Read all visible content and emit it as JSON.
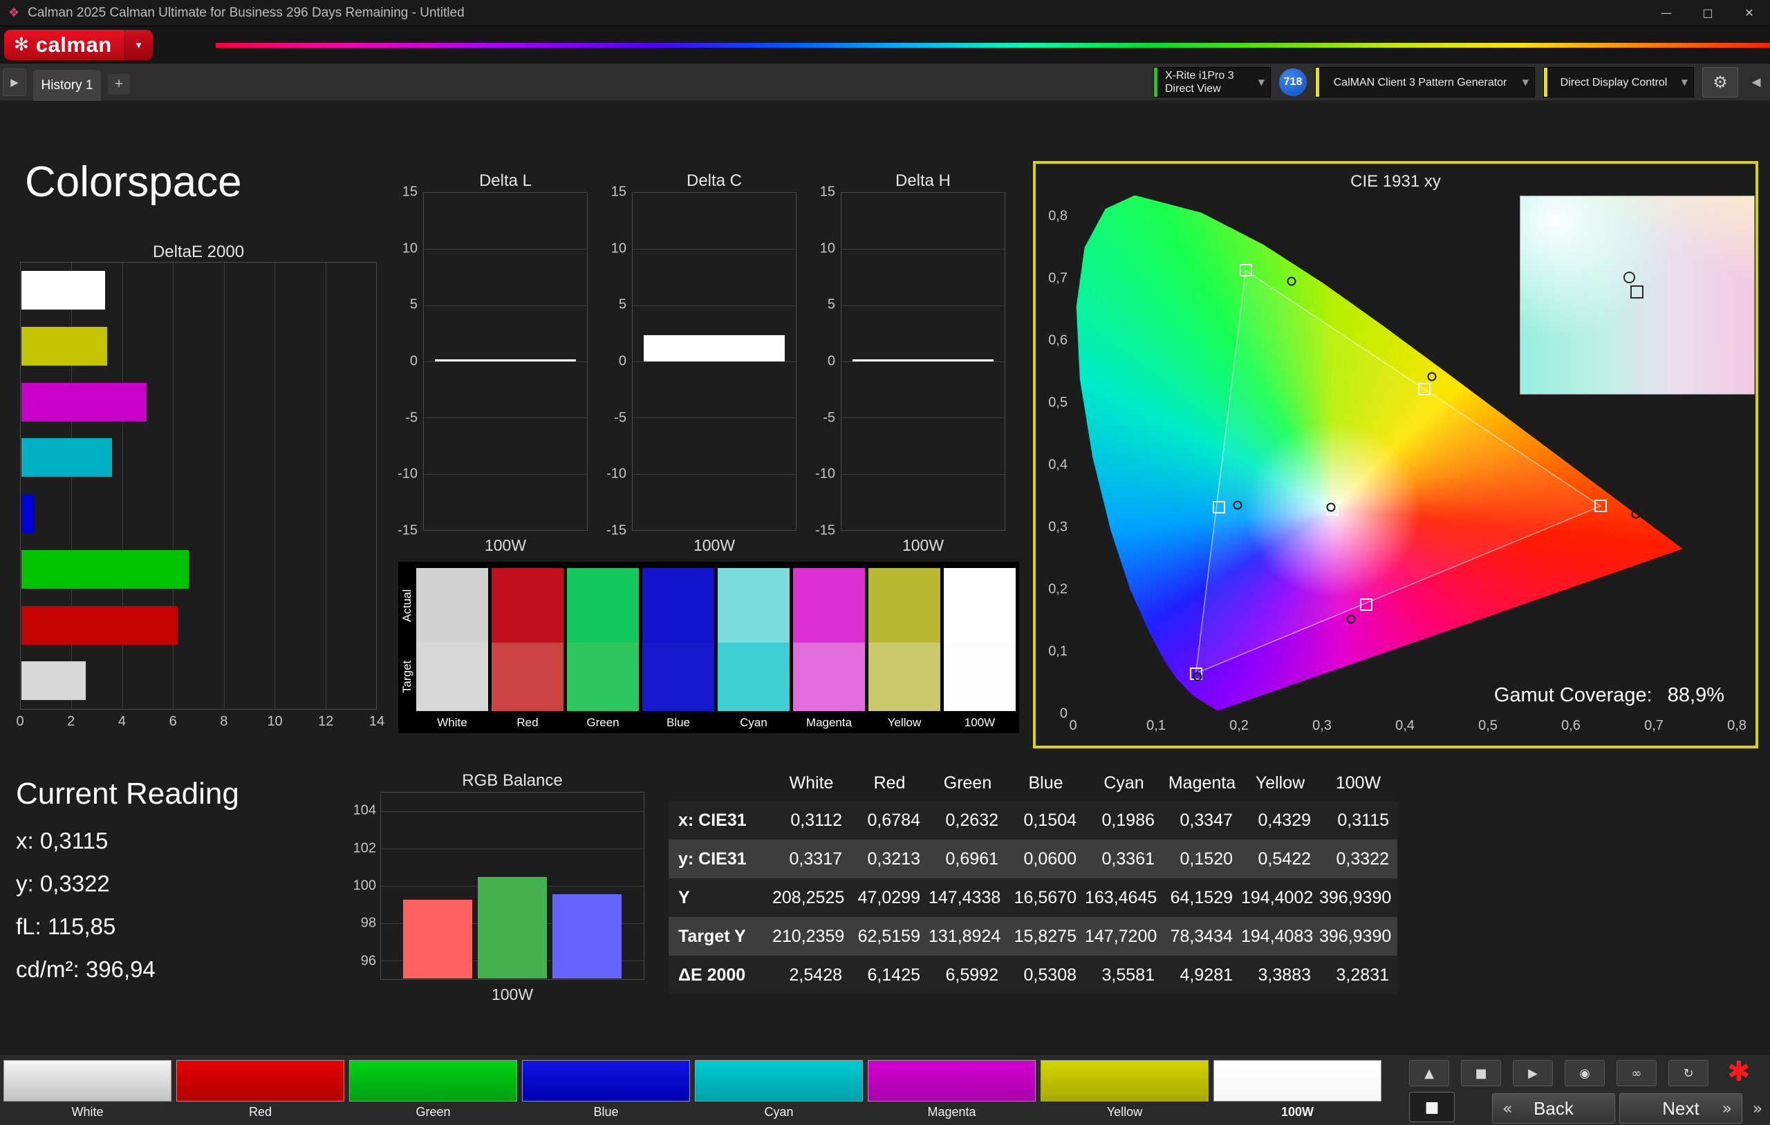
{
  "window": {
    "title": "Calman 2025 Calman Ultimate for Business 296 Days Remaining - Untitled"
  },
  "icons": {
    "app": "❖",
    "logo_flower": "✻",
    "menu_arrow": "▾",
    "dropdown_arrow": "▼",
    "expand": "▶",
    "collapse": "◀",
    "gear": "⚙",
    "minimize": "—",
    "maximize": "□",
    "close": "✕",
    "back_chevron": "«",
    "next_chevron": "»",
    "asterisk": "✱",
    "big_stop": "■"
  },
  "brand": {
    "logo_text": "calman"
  },
  "nav": {
    "history_tab": "History 1",
    "add_tab": "+",
    "meter_line1": "X-Rite i1Pro 3",
    "meter_line2": "Direct View",
    "badge": "718",
    "pattern_generator": "CalMAN Client 3 Pattern Generator",
    "display_control": "Direct Display Control"
  },
  "page_title": "Colorspace",
  "chart_data": [
    {
      "type": "bar",
      "title": "DeltaE 2000",
      "orientation": "horizontal",
      "xlim": [
        0,
        14
      ],
      "xticks": [
        0,
        2,
        4,
        6,
        8,
        10,
        12,
        14
      ],
      "categories": [
        "100W",
        "Yellow",
        "Magenta",
        "Cyan",
        "Blue",
        "Green",
        "Red",
        "White"
      ],
      "values": [
        3.2831,
        3.3883,
        4.9281,
        3.5581,
        0.5308,
        6.5992,
        6.1425,
        2.5428
      ],
      "colors": [
        "#ffffff",
        "#c3c400",
        "#cb00cb",
        "#00b2c4",
        "#0000d8",
        "#00c400",
        "#c40000",
        "#d8d8d8"
      ]
    },
    {
      "type": "bar",
      "title": "Delta L",
      "ylim": [
        -15,
        15
      ],
      "yticks": [
        15,
        10,
        5,
        0,
        -5,
        -10,
        -15
      ],
      "categories": [
        "100W"
      ],
      "values": [
        0.05
      ],
      "xlabel": "100W"
    },
    {
      "type": "bar",
      "title": "Delta C",
      "ylim": [
        -15,
        15
      ],
      "yticks": [
        15,
        10,
        5,
        0,
        -5,
        -10,
        -15
      ],
      "categories": [
        "100W"
      ],
      "values": [
        2.3
      ],
      "xlabel": "100W"
    },
    {
      "type": "bar",
      "title": "Delta H",
      "ylim": [
        -15,
        15
      ],
      "yticks": [
        15,
        10,
        5,
        0,
        -5,
        -10,
        -15
      ],
      "categories": [
        "100W"
      ],
      "values": [
        -0.05
      ],
      "xlabel": "100W"
    },
    {
      "type": "bar",
      "title": "RGB Balance",
      "ylim": [
        95,
        105
      ],
      "yticks": [
        104,
        102,
        100,
        98,
        96
      ],
      "categories": [
        "Red",
        "Green",
        "Blue"
      ],
      "values": [
        99.2,
        100.4,
        99.5
      ],
      "colors": [
        "#ff6060",
        "#44b04e",
        "#6464ff"
      ],
      "xlabel": "100W"
    },
    {
      "type": "scatter",
      "title": "CIE 1931 xy",
      "xlim": [
        0,
        0.8
      ],
      "ylim": [
        0,
        0.8
      ],
      "xticks": [
        "0",
        "0,1",
        "0,2",
        "0,3",
        "0,4",
        "0,5",
        "0,6",
        "0,7",
        "0,8"
      ],
      "yticks": [
        "0,8",
        "0,7",
        "0,6",
        "0,5",
        "0,4",
        "0,3",
        "0,2",
        "0,1",
        "0"
      ],
      "gamut_coverage_label": "Gamut Coverage:",
      "gamut_coverage_value": "88,9%",
      "targets": [
        {
          "name": "green",
          "x": 0.208,
          "y": 0.713
        },
        {
          "name": "yellow",
          "x": 0.423,
          "y": 0.522
        },
        {
          "name": "red",
          "x": 0.636,
          "y": 0.334
        },
        {
          "name": "white",
          "x": 0.3127,
          "y": 0.329
        },
        {
          "name": "cyan",
          "x": 0.176,
          "y": 0.332
        },
        {
          "name": "magenta",
          "x": 0.353,
          "y": 0.176
        },
        {
          "name": "blue",
          "x": 0.148,
          "y": 0.065
        }
      ],
      "measured": [
        {
          "name": "green",
          "x": 0.2632,
          "y": 0.6961
        },
        {
          "name": "yellow",
          "x": 0.4329,
          "y": 0.5422
        },
        {
          "name": "red",
          "x": 0.6784,
          "y": 0.3213
        },
        {
          "name": "white",
          "x": 0.3112,
          "y": 0.3317
        },
        {
          "name": "cyan",
          "x": 0.1986,
          "y": 0.3361
        },
        {
          "name": "magenta",
          "x": 0.3347,
          "y": 0.152
        },
        {
          "name": "blue",
          "x": 0.1504,
          "y": 0.06
        }
      ]
    }
  ],
  "swatch_compare": {
    "row_labels": [
      "Actual",
      "Target"
    ],
    "columns": [
      {
        "label": "White",
        "actual": "#d2d2d2",
        "target": "#d7d7d7"
      },
      {
        "label": "Red",
        "actual": "#c31020",
        "target": "#cd4343"
      },
      {
        "label": "Green",
        "actual": "#12c75e",
        "target": "#2cc75e"
      },
      {
        "label": "Blue",
        "actual": "#1414cd",
        "target": "#1818cd"
      },
      {
        "label": "Cyan",
        "actual": "#7adbdb",
        "target": "#3ccfd4"
      },
      {
        "label": "Magenta",
        "actual": "#dc30d3",
        "target": "#e26edd"
      },
      {
        "label": "Yellow",
        "actual": "#b8b930",
        "target": "#c9c96c"
      },
      {
        "label": "100W",
        "actual": "#ffffff",
        "target": "#fdfdfd"
      }
    ]
  },
  "current_reading": {
    "title": "Current Reading",
    "lines": [
      "x: 0,3115",
      "y: 0,3322",
      "fL: 115,85",
      "cd/m²: 396,94"
    ]
  },
  "table": {
    "columns": [
      "White",
      "Red",
      "Green",
      "Blue",
      "Cyan",
      "Magenta",
      "Yellow",
      "100W"
    ],
    "rows": [
      {
        "label": "x: CIE31",
        "alt": false,
        "values": [
          "0,3112",
          "0,6784",
          "0,2632",
          "0,1504",
          "0,1986",
          "0,3347",
          "0,4329",
          "0,3115"
        ]
      },
      {
        "label": "y: CIE31",
        "alt": true,
        "values": [
          "0,3317",
          "0,3213",
          "0,6961",
          "0,0600",
          "0,3361",
          "0,1520",
          "0,5422",
          "0,3322"
        ]
      },
      {
        "label": "Y",
        "alt": false,
        "values": [
          "208,2525",
          "47,0299",
          "147,4338",
          "16,5670",
          "163,4645",
          "64,1529",
          "194,4002",
          "396,9390"
        ]
      },
      {
        "label": "Target Y",
        "alt": true,
        "values": [
          "210,2359",
          "62,5159",
          "131,8924",
          "15,8275",
          "147,7200",
          "78,3434",
          "194,4083",
          "396,9390"
        ]
      },
      {
        "label": "ΔE 2000",
        "alt": false,
        "values": [
          "2,5428",
          "6,1425",
          "6,5992",
          "0,5308",
          "3,5581",
          "4,9281",
          "3,3883",
          "3,2831"
        ]
      }
    ]
  },
  "bottom": {
    "patterns": [
      {
        "label": "White",
        "color1": "#f4f4f4",
        "color2": "#c2c2c2"
      },
      {
        "label": "Red",
        "color1": "#e60000",
        "color2": "#b00000"
      },
      {
        "label": "Green",
        "color1": "#00d414",
        "color2": "#00a010"
      },
      {
        "label": "Blue",
        "color1": "#1414e6",
        "color2": "#0000b0"
      },
      {
        "label": "Cyan",
        "color1": "#00ccd4",
        "color2": "#00a0a8"
      },
      {
        "label": "Magenta",
        "color1": "#d400d4",
        "color2": "#a800a8"
      },
      {
        "label": "Yellow",
        "color1": "#d4d600",
        "color2": "#a8aa00"
      },
      {
        "label": "100W",
        "color1": "#ffffff",
        "color2": "#f6f6f6"
      }
    ],
    "controls": [
      {
        "name": "eject",
        "glyph": "▲"
      },
      {
        "name": "stop",
        "glyph": "■"
      },
      {
        "name": "play",
        "glyph": "▶"
      },
      {
        "name": "camera",
        "glyph": "◉"
      },
      {
        "name": "loop",
        "glyph": "∞"
      },
      {
        "name": "refresh",
        "glyph": "↻"
      }
    ],
    "back_label": "Back",
    "next_label": "Next"
  }
}
